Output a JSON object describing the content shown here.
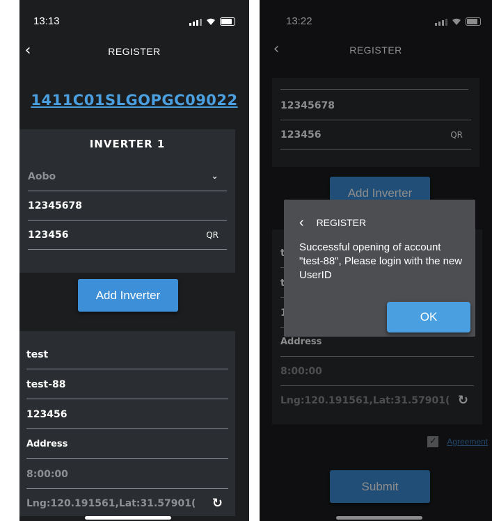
{
  "left": {
    "status": {
      "time": "13:13"
    },
    "nav": {
      "title": "REGISTER"
    },
    "serial": "1411C01SLGOPGC09022",
    "inverter": {
      "heading": "INVERTER 1",
      "brand": "Aobo",
      "field1": "12345678",
      "field2": "123456",
      "qr_label": "QR"
    },
    "add_button": "Add Inverter",
    "account": {
      "field1": "test",
      "field2": "test-88",
      "field3": "123456",
      "address": "Address",
      "time": "8:00:00",
      "location": "Lng:120.191561,Lat:31.57901("
    }
  },
  "right": {
    "status": {
      "time": "13:22"
    },
    "nav": {
      "title": "REGISTER"
    },
    "inverter": {
      "field1": "12345678",
      "field2": "123456",
      "qr_label": "QR"
    },
    "add_button": "Add Inverter",
    "account": {
      "field1": "test",
      "field2": "test",
      "field3": "123456",
      "address": "Address",
      "time": "8:00:00",
      "location": "Lng:120.191561,Lat:31.57901("
    },
    "agreement": "Agreement",
    "submit": "Submit",
    "dialog": {
      "title": "REGISTER",
      "message": "Successful opening of account \"test-88\", Please login with the new UserID",
      "ok": "OK"
    }
  },
  "colors": {
    "background": "#1c1d1f",
    "card": "#2a2d31",
    "accent": "#3d8fd8",
    "serial_link": "#4a9fe0"
  },
  "icons": [
    "back-chevron-icon",
    "chevron-down-icon",
    "refresh-icon",
    "signal-icon",
    "wifi-icon",
    "battery-icon",
    "checkbox-checked-icon"
  ]
}
